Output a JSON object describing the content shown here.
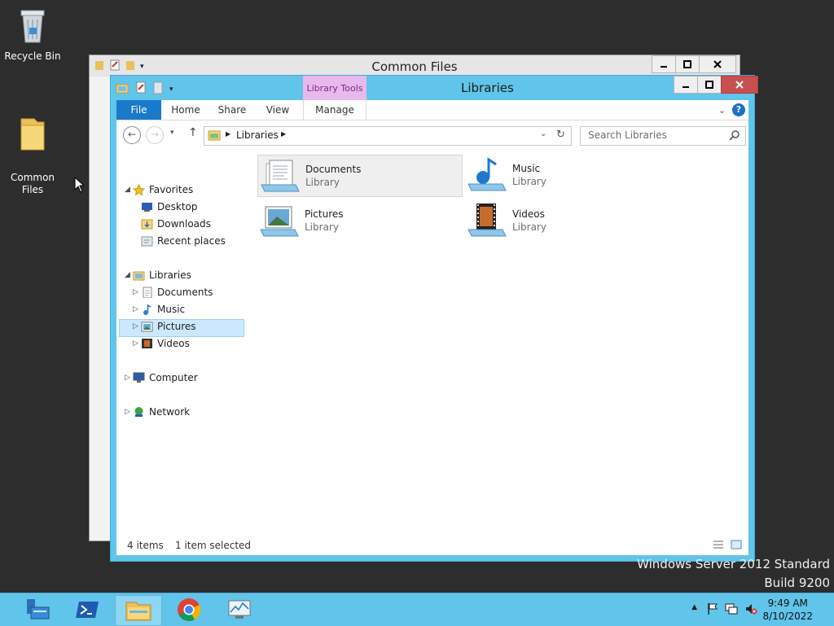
{
  "desktop": {
    "icons": [
      {
        "label": "Recycle Bin",
        "icon": "recycle-bin-icon"
      },
      {
        "label": "Common\nFiles",
        "icon": "folder-icon"
      }
    ],
    "watermark_line1": "Windows Server 2012 Standard",
    "watermark_line2": "Build 9200"
  },
  "back_window": {
    "title": "Common Files",
    "minimize": "–",
    "maximize": "□",
    "close": "✕"
  },
  "front_window": {
    "title": "Libraries",
    "contextual_tab_group": "Library Tools",
    "minimize": "–",
    "maximize": "□",
    "close": "✕",
    "ribbon_tabs": [
      "File",
      "Home",
      "Share",
      "View",
      "Manage"
    ],
    "address": {
      "path": "Libraries"
    },
    "search": {
      "placeholder": "Search Libraries"
    },
    "nav_tree": {
      "favorites": {
        "label": "Favorites",
        "children": [
          "Desktop",
          "Downloads",
          "Recent places"
        ]
      },
      "libraries": {
        "label": "Libraries",
        "children": [
          "Documents",
          "Music",
          "Pictures",
          "Videos"
        ]
      },
      "computer": "Computer",
      "network": "Network"
    },
    "items": [
      {
        "name": "Documents",
        "type": "Library",
        "icon": "documents-library-icon",
        "selected": true
      },
      {
        "name": "Music",
        "type": "Library",
        "icon": "music-library-icon",
        "selected": false
      },
      {
        "name": "Pictures",
        "type": "Library",
        "icon": "pictures-library-icon",
        "selected": false
      },
      {
        "name": "Videos",
        "type": "Library",
        "icon": "videos-library-icon",
        "selected": false
      }
    ],
    "status": {
      "count": "4 items",
      "selection": "1 item selected"
    }
  },
  "taskbar": {
    "buttons": [
      {
        "icon": "server-manager-icon",
        "active": false
      },
      {
        "icon": "powershell-icon",
        "active": false
      },
      {
        "icon": "file-explorer-icon",
        "active": true
      },
      {
        "icon": "chrome-icon",
        "active": false
      },
      {
        "icon": "performance-monitor-icon",
        "active": false
      }
    ],
    "clock": {
      "time": "9:49 AM",
      "date": "8/10/2022"
    }
  },
  "colors": {
    "desktop": "#2d2d2d",
    "window_frame": "#61c4ea",
    "file_tab": "#1979ca",
    "selection": "#cce8ff",
    "library_tools": "#e8b9ec"
  }
}
